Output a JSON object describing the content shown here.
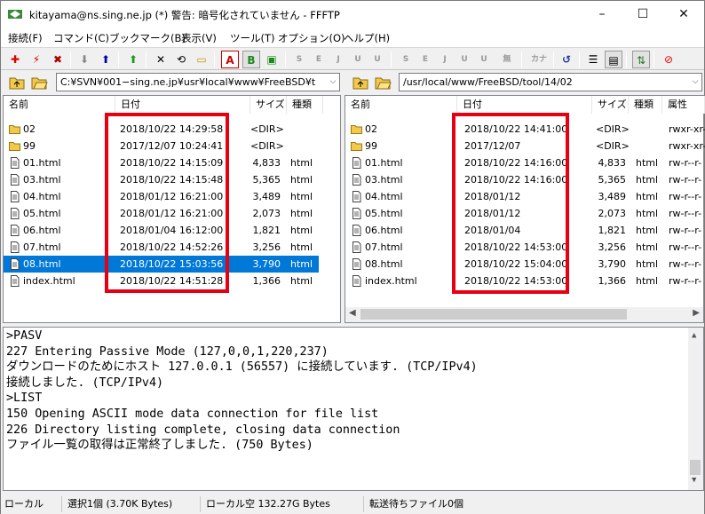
{
  "window": {
    "title": "kitayama@ns.sing.ne.jp (*) 警告: 暗号化されていません - FFFTP",
    "minimize": "–",
    "maximize": "☐",
    "close": "✕"
  },
  "menu": [
    "接続(F)",
    "コマンド(C)",
    "ブックマーク(B)",
    "表示(V)",
    "ツール(T)",
    "オプション(O)",
    "ヘルプ(H)"
  ],
  "toolbar": {
    "binary_mode": "B",
    "ascii_mode": "A",
    "kana": "カナ",
    "sjis": "S",
    "euc": "E",
    "jis": "J",
    "utf8": "U",
    "utf8n": "U",
    "none": "無"
  },
  "local": {
    "path": "C:¥SVN¥001−sing.ne.jp¥usr¥local¥www¥FreeBSD¥t",
    "columns": [
      "名前",
      "日付",
      "サイズ",
      "種類"
    ],
    "files": [
      {
        "name": "02",
        "date": "2018/10/22 14:29:58",
        "size": "<DIR>",
        "type": "",
        "kind": "folder"
      },
      {
        "name": "99",
        "date": "2017/12/07 10:24:41",
        "size": "<DIR>",
        "type": "",
        "kind": "folder"
      },
      {
        "name": "01.html",
        "date": "2018/10/22 14:15:09",
        "size": "4,833",
        "type": "html",
        "kind": "file"
      },
      {
        "name": "03.html",
        "date": "2018/10/22 14:15:48",
        "size": "5,365",
        "type": "html",
        "kind": "file"
      },
      {
        "name": "04.html",
        "date": "2018/01/12 16:21:00",
        "size": "3,489",
        "type": "html",
        "kind": "file"
      },
      {
        "name": "05.html",
        "date": "2018/01/12 16:21:00",
        "size": "2,073",
        "type": "html",
        "kind": "file"
      },
      {
        "name": "06.html",
        "date": "2018/01/04 16:12:00",
        "size": "1,821",
        "type": "html",
        "kind": "file"
      },
      {
        "name": "07.html",
        "date": "2018/10/22 14:52:26",
        "size": "3,256",
        "type": "html",
        "kind": "file"
      },
      {
        "name": "08.html",
        "date": "2018/10/22 15:03:56",
        "size": "3,790",
        "type": "html",
        "kind": "file",
        "selected": true
      },
      {
        "name": "index.html",
        "date": "2018/10/22 14:51:28",
        "size": "1,366",
        "type": "html",
        "kind": "file"
      }
    ]
  },
  "remote": {
    "path": "/usr/local/www/FreeBSD/tool/14/02",
    "columns": [
      "名前",
      "日付",
      "サイズ",
      "種類",
      "属性"
    ],
    "files": [
      {
        "name": "02",
        "date": "2018/10/22 14:41:00",
        "size": "<DIR>",
        "type": "",
        "attr": "rwxr-xr-",
        "kind": "folder"
      },
      {
        "name": "99",
        "date": "2017/12/07",
        "size": "<DIR>",
        "type": "",
        "attr": "rwxr-xr-",
        "kind": "folder"
      },
      {
        "name": "01.html",
        "date": "2018/10/22 14:16:00",
        "size": "4,833",
        "type": "html",
        "attr": "rw-r--r-",
        "kind": "file"
      },
      {
        "name": "03.html",
        "date": "2018/10/22 14:16:00",
        "size": "5,365",
        "type": "html",
        "attr": "rw-r--r-",
        "kind": "file"
      },
      {
        "name": "04.html",
        "date": "2018/01/12",
        "size": "3,489",
        "type": "html",
        "attr": "rw-r--r-",
        "kind": "file"
      },
      {
        "name": "05.html",
        "date": "2018/01/12",
        "size": "2,073",
        "type": "html",
        "attr": "rw-r--r-",
        "kind": "file"
      },
      {
        "name": "06.html",
        "date": "2018/01/04",
        "size": "1,821",
        "type": "html",
        "attr": "rw-r--r-",
        "kind": "file"
      },
      {
        "name": "07.html",
        "date": "2018/10/22 14:53:00",
        "size": "3,256",
        "type": "html",
        "attr": "rw-r--r-",
        "kind": "file"
      },
      {
        "name": "08.html",
        "date": "2018/10/22 15:04:00",
        "size": "3,790",
        "type": "html",
        "attr": "rw-r--r-",
        "kind": "file"
      },
      {
        "name": "index.html",
        "date": "2018/10/22 14:53:00",
        "size": "1,366",
        "type": "html",
        "attr": "rw-r--r-",
        "kind": "file"
      }
    ]
  },
  "log": [
    ">PASV",
    "227 Entering Passive Mode (127,0,0,1,220,237)",
    "ダウンロードのためにホスト 127.0.0.1 (56557) に接続しています. (TCP/IPv4)",
    "接続しました. (TCP/IPv4)",
    ">LIST",
    "150 Opening ASCII mode data connection for file list",
    "226 Directory listing complete, closing data connection",
    "ファイル一覧の取得は正常終了しました. (750 Bytes)"
  ],
  "status": {
    "mode": "ローカル",
    "selection": "選択1個 (3.70K Bytes)",
    "local_free": "ローカル空 132.27G Bytes",
    "queue": "転送待ちファイル0個"
  },
  "colors": {
    "highlight": "#e60012",
    "selection": "#0078d7",
    "folder": "#f2c94c"
  }
}
